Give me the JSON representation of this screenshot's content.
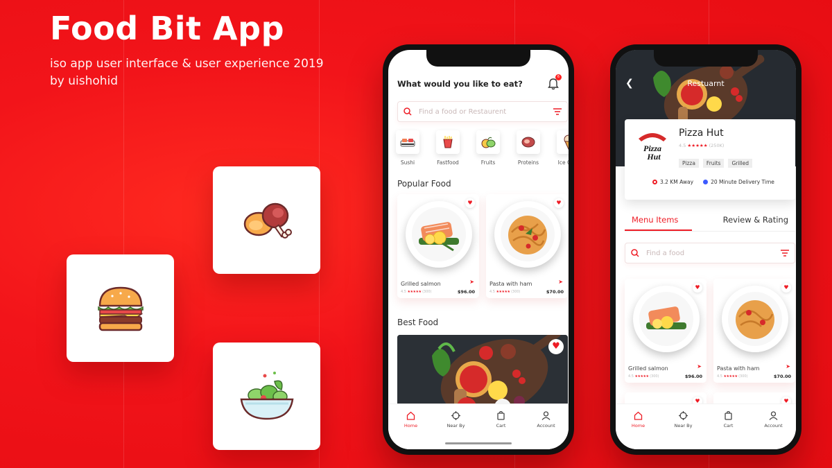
{
  "hero": {
    "title": "Food Bit App",
    "subtitle_line1": "iso app user interface & user experience 2019",
    "subtitle_line2": "by uishohid"
  },
  "colors": {
    "accent": "#ee1c25",
    "background": "#f20f12",
    "dark": "#262b31"
  },
  "feature_tiles": [
    {
      "icon": "chicken-leg-icon"
    },
    {
      "icon": "burger-icon"
    },
    {
      "icon": "salad-bowl-icon"
    }
  ],
  "home_screen": {
    "question": "What would  you like to eat?",
    "notification_count": "6",
    "search_placeholder": "Find a food or Restaurent",
    "categories": [
      {
        "label": "Sushi",
        "icon": "sushi-icon"
      },
      {
        "label": "Fastfood",
        "icon": "fastfood-icon"
      },
      {
        "label": "Fruits",
        "icon": "fruits-icon"
      },
      {
        "label": "Proteins",
        "icon": "proteins-icon"
      },
      {
        "label": "Ice Crea",
        "icon": "ice-cream-icon"
      }
    ],
    "popular_title": "Popular Food",
    "popular_items": [
      {
        "name": "Grilled salmon",
        "rating": "4.5",
        "stars": "★★★★★",
        "reviews": "(300)",
        "price": "$96.00"
      },
      {
        "name": "Pasta with ham",
        "rating": "4.5",
        "stars": "★★★★★",
        "reviews": "(300)",
        "price": "$70.00"
      }
    ],
    "best_title": "Best  Food"
  },
  "tabbar": [
    {
      "label": "Home",
      "icon": "home-icon",
      "active": true
    },
    {
      "label": "Near By",
      "icon": "crosshair-icon",
      "active": false
    },
    {
      "label": "Cart",
      "icon": "cart-icon",
      "active": false
    },
    {
      "label": "Account",
      "icon": "user-icon",
      "active": false
    }
  ],
  "restaurant_screen": {
    "title": "Restuarnt",
    "name": "Pizza Hut",
    "logo_text": "Pizza Hut",
    "rating": "4.5",
    "stars": "★★★★★",
    "reviews": "(250K)",
    "tags": [
      "Pizza",
      "Fruits",
      "Grilled"
    ],
    "distance": "3.2 KM  Away",
    "delivery": "20 Minute Delivery Time",
    "tab_menu": "Menu Items",
    "tab_review": "Review & Rating",
    "search_placeholder": "Find a food",
    "items": [
      {
        "name": "Grilled salmon",
        "rating": "4.5",
        "stars": "★★★★★",
        "reviews": "(300)",
        "price": "$96.00"
      },
      {
        "name": "Pasta with ham",
        "rating": "4.5",
        "stars": "★★★★★",
        "reviews": "(300)",
        "price": "$70.00"
      }
    ]
  }
}
